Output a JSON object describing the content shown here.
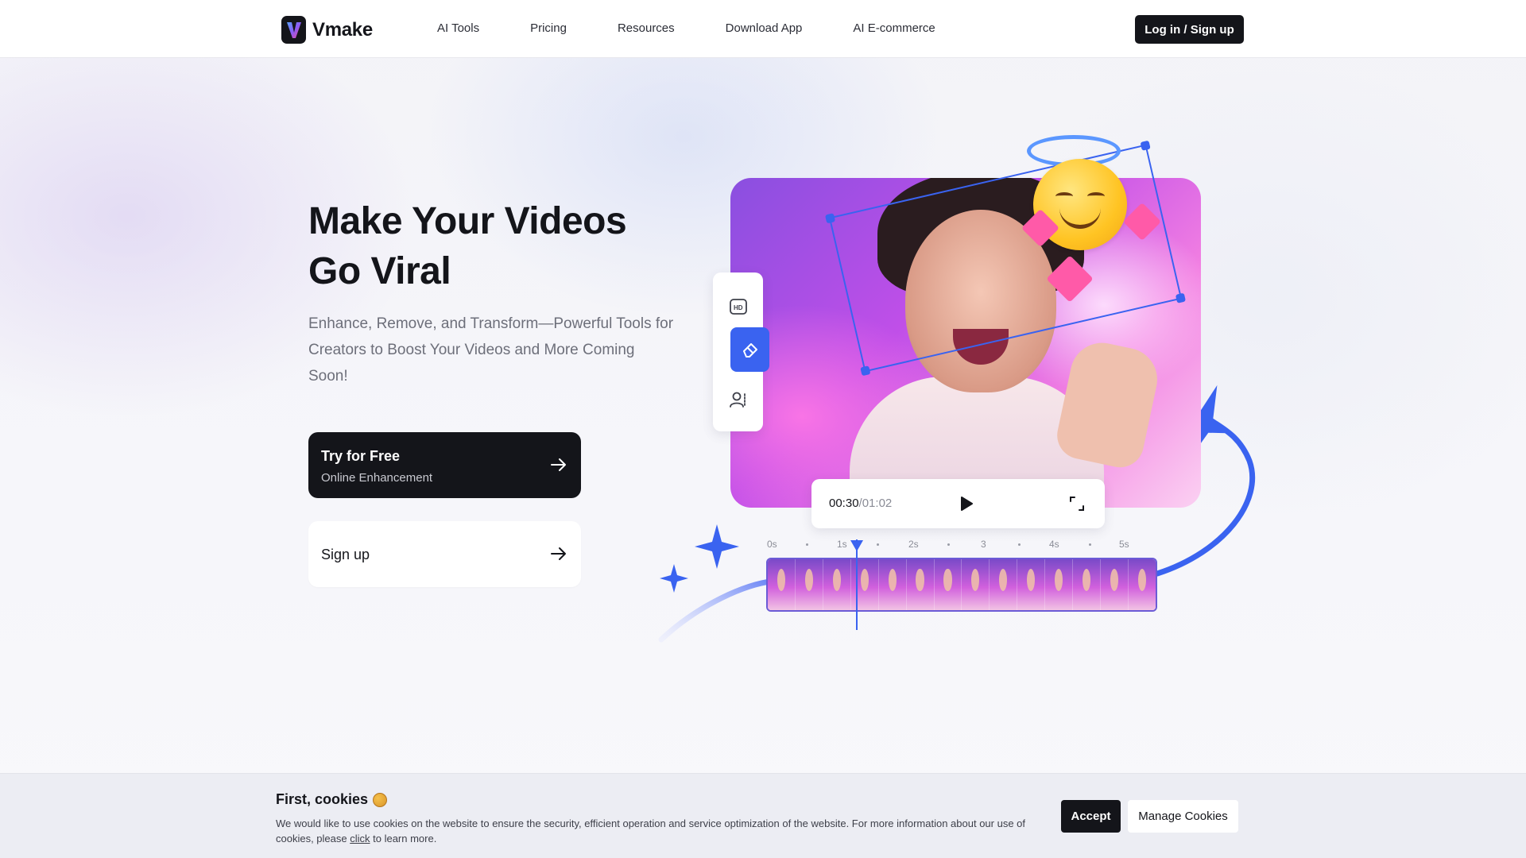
{
  "nav": {
    "brand": "Vmake",
    "links": [
      "AI Tools",
      "Pricing",
      "Resources",
      "Download App",
      "AI E-commerce"
    ],
    "login_label": "Log in / Sign up"
  },
  "hero": {
    "title_line1": "Make Your Videos",
    "title_line2": "Go Viral",
    "subtitle": "Enhance, Remove, and Transform—Powerful Tools for Creators to Boost Your Videos and More Coming Soon!",
    "try_button": {
      "title": "Try for Free",
      "subtitle": "Online Enhancement"
    },
    "signup_button": {
      "title": "Sign up"
    }
  },
  "demo": {
    "tools": [
      "hd-icon",
      "eraser-icon",
      "person-remove-icon"
    ],
    "player": {
      "current": "00:30",
      "duration": "/01:02"
    },
    "timeline_labels": [
      "0s",
      "1s",
      "2s",
      "3",
      "4s",
      "5s"
    ],
    "accent_color": "#3a63f0"
  },
  "cookie": {
    "title": "First, cookies",
    "text_before": "We would like to use cookies on the website to ensure the security, efficient operation and service optimization of the website. For more information about our use of cookies, please ",
    "link": "click",
    "text_after": " to learn more.",
    "accept_label": "Accept",
    "manage_label": "Manage Cookies"
  }
}
